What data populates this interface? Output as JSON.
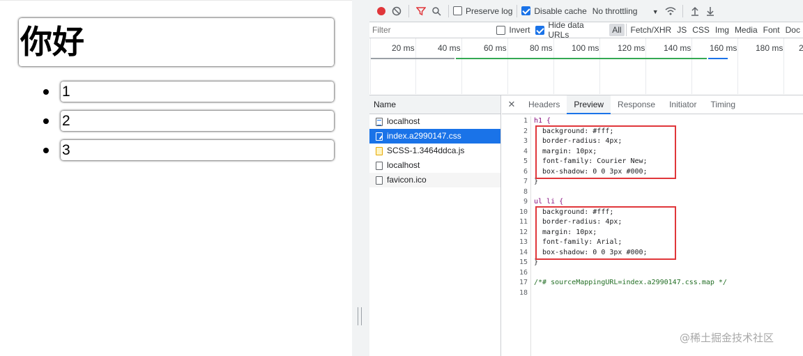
{
  "page": {
    "heading": "你好",
    "list_items": [
      "1",
      "2",
      "3"
    ]
  },
  "toolbar": {
    "preserve_log": "Preserve log",
    "disable_cache": "Disable cache",
    "throttling": "No throttling"
  },
  "filter": {
    "placeholder": "Filter",
    "invert": "Invert",
    "hide_data_urls": "Hide data URLs",
    "types": [
      "All",
      "Fetch/XHR",
      "JS",
      "CSS",
      "Img",
      "Media",
      "Font",
      "Doc"
    ]
  },
  "timeline": {
    "ticks": [
      "20 ms",
      "40 ms",
      "60 ms",
      "80 ms",
      "100 ms",
      "120 ms",
      "140 ms",
      "160 ms",
      "180 ms",
      "2"
    ]
  },
  "requests": {
    "header": "Name",
    "rows": [
      {
        "name": "localhost",
        "icon": "document-icon"
      },
      {
        "name": "index.a2990147.css",
        "icon": "css-file-icon"
      },
      {
        "name": "SCSS-1.3464ddca.js",
        "icon": "js-file-icon"
      },
      {
        "name": "localhost",
        "icon": "blank-file-icon"
      },
      {
        "name": "favicon.ico",
        "icon": "blank-file-icon"
      }
    ]
  },
  "detail_tabs": [
    "Headers",
    "Preview",
    "Response",
    "Initiator",
    "Timing"
  ],
  "code": {
    "line_numbers": [
      "1",
      "2",
      "3",
      "4",
      "5",
      "6",
      "7",
      "8",
      "9",
      "10",
      "11",
      "12",
      "13",
      "14",
      "15",
      "16",
      "17",
      "18"
    ],
    "lines": [
      "h1 {",
      "  background: #fff;",
      "  border-radius: 4px;",
      "  margin: 10px;",
      "  font-family: Courier New;",
      "  box-shadow: 0 0 3px #000;",
      "}",
      "",
      "ul li {",
      "  background: #fff;",
      "  border-radius: 4px;",
      "  margin: 10px;",
      "  font-family: Arial;",
      "  box-shadow: 0 0 3px #000;",
      "}",
      "",
      "/*# sourceMappingURL=index.a2990147.css.map */",
      ""
    ]
  },
  "watermark": "@稀土掘金技术社区",
  "colors": {
    "accent": "#1a73e8",
    "record": "#e0363a",
    "highlight_box": "#e0363a"
  }
}
